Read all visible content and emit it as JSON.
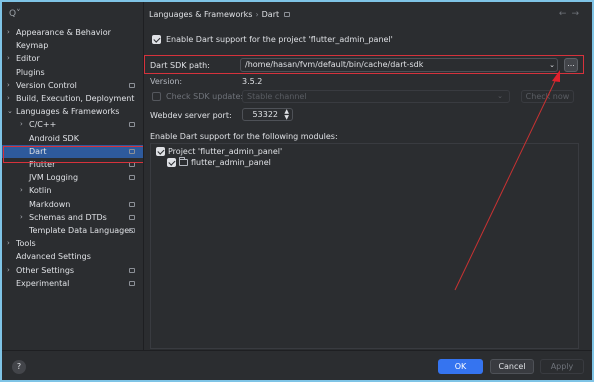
{
  "search": {
    "icon": "search-icon",
    "value": ""
  },
  "sidebar": {
    "items": [
      {
        "label": "Appearance & Behavior",
        "arrow": ">",
        "badge": false
      },
      {
        "label": "Keymap",
        "arrow": "",
        "badge": false
      },
      {
        "label": "Editor",
        "arrow": ">",
        "badge": false
      },
      {
        "label": "Plugins",
        "arrow": "",
        "badge": false
      },
      {
        "label": "Version Control",
        "arrow": ">",
        "badge": true
      },
      {
        "label": "Build, Execution, Deployment",
        "arrow": ">",
        "badge": false
      },
      {
        "label": "Languages & Frameworks",
        "arrow": "v",
        "badge": false
      },
      {
        "label": "C/C++",
        "arrow": ">",
        "badge": true
      },
      {
        "label": "Android SDK",
        "arrow": "",
        "badge": false
      },
      {
        "label": "Dart",
        "arrow": "",
        "badge": true,
        "selected": true
      },
      {
        "label": "Flutter",
        "arrow": "",
        "badge": true
      },
      {
        "label": "JVM Logging",
        "arrow": "",
        "badge": true
      },
      {
        "label": "Kotlin",
        "arrow": ">",
        "badge": false
      },
      {
        "label": "Markdown",
        "arrow": "",
        "badge": true
      },
      {
        "label": "Schemas and DTDs",
        "arrow": ">",
        "badge": true
      },
      {
        "label": "Template Data Languages",
        "arrow": "",
        "badge": true
      },
      {
        "label": "Tools",
        "arrow": ">",
        "badge": false
      },
      {
        "label": "Advanced Settings",
        "arrow": "",
        "badge": false
      },
      {
        "label": "Other Settings",
        "arrow": ">",
        "badge": true
      },
      {
        "label": "Experimental",
        "arrow": "",
        "badge": true
      }
    ]
  },
  "breadcrumb": {
    "parent": "Languages & Frameworks",
    "separator": "›",
    "current": "Dart"
  },
  "nav": {
    "back": "←",
    "forward": "→"
  },
  "enable_dart": {
    "label": "Enable Dart support for the project 'flutter_admin_panel'",
    "checked": true
  },
  "sdk": {
    "label": "Dart SDK path:",
    "path": "/home/hasan/fvm/default/bin/cache/dart-sdk",
    "dropdown": "⌄",
    "browse": "..."
  },
  "version": {
    "label": "Version:",
    "value": "3.5.2"
  },
  "check_sdk": {
    "label": "Check SDK update:",
    "channel": "Stable channel",
    "button": "Check now"
  },
  "webdev": {
    "label": "Webdev server port:",
    "value": "53322"
  },
  "modules": {
    "label": "Enable Dart support for the following modules:",
    "project": "Project 'flutter_admin_panel'",
    "module": "flutter_admin_panel"
  },
  "footer": {
    "help": "?",
    "ok": "OK",
    "cancel": "Cancel",
    "apply": "Apply"
  },
  "colors": {
    "accent": "#3574f0",
    "selection": "#2e5a9c",
    "annotation": "#d6323c"
  }
}
